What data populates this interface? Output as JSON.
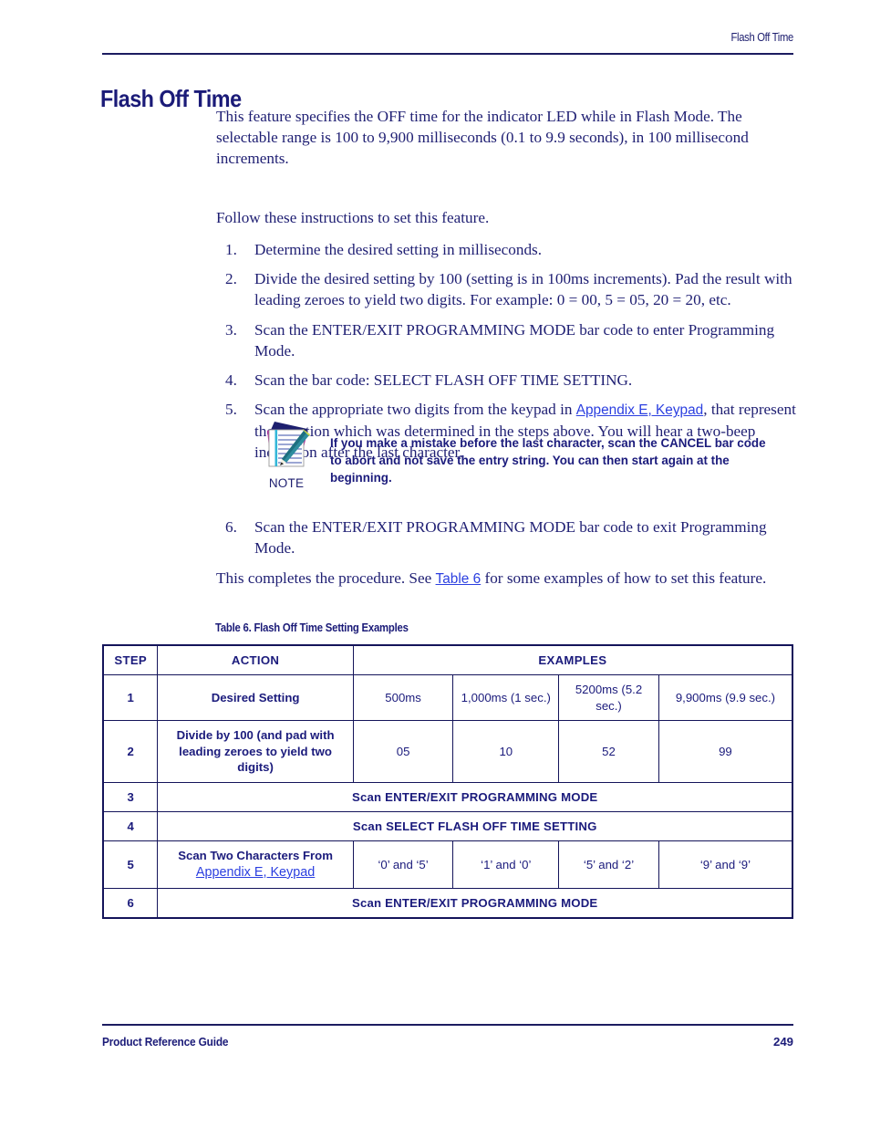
{
  "header": {
    "running_title": "Flash Off Time"
  },
  "title": "Flash Off Time",
  "intro": {
    "paragraph1": "This feature specifies the OFF time for the indicator LED while in Flash Mode. The selectable range is 100 to 9,900 milliseconds (0.1 to 9.9 seconds), in 100 millisecond increments.",
    "paragraph2": "Follow these instructions to set this feature."
  },
  "steps": [
    {
      "num": "1.",
      "text": "Determine the desired setting in milliseconds."
    },
    {
      "num": "2.",
      "text": "Divide the desired setting by 100 (setting is in 100ms increments). Pad the result with leading zeroes to yield two digits. For example: 0 = 00, 5 = 05, 20 = 20, etc."
    },
    {
      "num": "3.",
      "text": "Scan the ENTER/EXIT PROGRAMMING MODE bar code to enter Programming Mode."
    },
    {
      "num": "4.",
      "text": "Scan the bar code: SELECT FLASH OFF TIME SETTING."
    },
    {
      "num": "5.",
      "text_before_link": "Scan the appropriate two digits from the keypad in ",
      "link": "Appendix E, Keypad",
      "text_after_link": ", that represent the duration which was determined in the steps above. You will hear a two-beep indication after the last character."
    }
  ],
  "note": {
    "label": "NOTE",
    "icon": "notepad-pencil-icon",
    "text": "If you make a mistake before the last character, scan the CANCEL bar code to abort and not save the entry string. You can then start again at the beginning."
  },
  "step6": {
    "num": "6.",
    "text": "Scan the ENTER/EXIT PROGRAMMING MODE bar code to exit Programming Mode."
  },
  "closing": {
    "text_before_link": "This completes the procedure. See ",
    "link": "Table 6",
    "text_after_link": " for some examples of how to set this feature."
  },
  "table": {
    "caption": "Table 6. Flash Off Time Setting Examples",
    "headers": {
      "step": "STEP",
      "action": "ACTION",
      "examples": "EXAMPLES"
    },
    "rows": [
      {
        "step": "1",
        "action": "Desired Setting",
        "values": [
          "500ms",
          "1,000ms (1 sec.)",
          "5200ms (5.2 sec.)",
          "9,900ms (9.9 sec.)"
        ]
      },
      {
        "step": "2",
        "action": "Divide by 100 (and pad with leading zeroes to yield two digits)",
        "values": [
          "05",
          "10",
          "52",
          "99"
        ]
      },
      {
        "step": "3",
        "span_text": "Scan ENTER/EXIT PROGRAMMING MODE"
      },
      {
        "step": "4",
        "span_text": "Scan SELECT FLASH OFF TIME SETTING"
      },
      {
        "step": "5",
        "action": "Scan Two Characters From",
        "action_link": "Appendix E, Keypad",
        "values": [
          "‘0’ and ‘5’",
          "‘1’ and ‘0’",
          "‘5’ and ‘2’",
          "‘9’ and ‘9’"
        ]
      },
      {
        "step": "6",
        "span_text": "Scan ENTER/EXIT PROGRAMMING MODE"
      }
    ]
  },
  "footer": {
    "guide": "Product Reference Guide",
    "page_number": "249"
  },
  "colors": {
    "navy_text": "#1f1f73",
    "navy_heading": "#1b1b78",
    "link_blue": "#2b3fe0",
    "rule": "#1c1c60"
  }
}
